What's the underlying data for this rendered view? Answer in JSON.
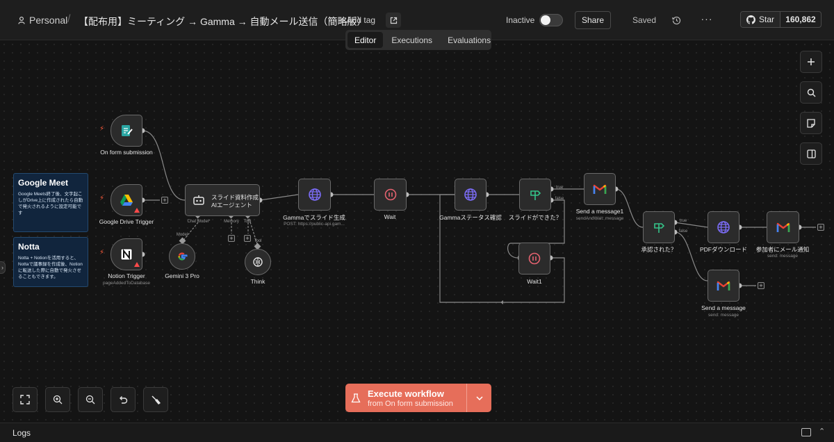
{
  "header": {
    "workspace": "Personal",
    "title": "【配布用】ミーティング → Gamma → 自動メール送信（簡略版）",
    "add_tag": "+ Add tag",
    "active_state_label": "Inactive",
    "share_label": "Share",
    "save_state": "Saved",
    "github_star_label": "Star",
    "github_star_count": "160,862"
  },
  "tabs": [
    {
      "label": "Editor",
      "active": true
    },
    {
      "label": "Executions",
      "active": false
    },
    {
      "label": "Evaluations",
      "active": false
    }
  ],
  "notes": {
    "google_meet": {
      "title": "Google Meet",
      "body": "Google Meets終了後、文字起こしがDrive上に作成されたら自動で発火されるように設定可能です"
    },
    "notta": {
      "title": "Notta",
      "body": "Notta + Notionを活用すると、Nottaで議事録を作成後、Notionに転送した際に自動で発火させることもできます。"
    }
  },
  "nodes": {
    "form_trigger": {
      "label": "On form submission",
      "icon": "form-icon"
    },
    "drive_trigger": {
      "label": "Google Drive Trigger",
      "icon": "google-drive-icon"
    },
    "notion_trigger": {
      "label": "Notion Trigger",
      "sub": "pageAddedToDatabase",
      "icon": "notion-icon"
    },
    "agent": {
      "label_line1": "スライド資料作成",
      "label_line2": "AIエージェント",
      "icon": "robot-icon",
      "port_chat": "Chat Model*",
      "port_memory": "Memory",
      "port_tool": "Tool"
    },
    "gemini": {
      "label": "Gemini 3 Pro",
      "port": "Model",
      "icon": "google-icon"
    },
    "think": {
      "label": "Think",
      "port": "Tool",
      "icon": "brain-icon"
    },
    "gamma_slide": {
      "label": "Gammaでスライド生成",
      "sub": "POST: https://public-api.gam...",
      "icon": "globe-icon"
    },
    "wait": {
      "label": "Wait",
      "icon": "pause-icon"
    },
    "gamma_status": {
      "label": "Gammaステータス確認",
      "icon": "globe-icon"
    },
    "slide_done": {
      "label": "スライドができた？",
      "true_label": "true",
      "false_label": "false",
      "icon": "if-icon"
    },
    "wait1": {
      "label": "Wait1",
      "icon": "pause-icon"
    },
    "send_message1": {
      "label": "Send a message1",
      "sub": "sendAndWait: message",
      "icon": "gmail-icon"
    },
    "approved": {
      "label": "承認された？",
      "true_label": "true",
      "false_label": "false",
      "icon": "if-icon"
    },
    "pdf_download": {
      "label": "PDFダウンロード",
      "icon": "globe-icon"
    },
    "notify": {
      "label": "参加者にメール通知",
      "sub": "send: message",
      "icon": "gmail-icon"
    },
    "send_message": {
      "label": "Send a message",
      "sub": "send: message",
      "icon": "gmail-icon"
    }
  },
  "execute": {
    "label": "Execute workflow",
    "sub": "from On form submission"
  },
  "logs": {
    "label": "Logs"
  },
  "colors": {
    "accent": "#e66e5a",
    "globe": "#7b6cf6",
    "wait": "#e5626f",
    "if": "#35c58a",
    "note_bg": "#11253d"
  }
}
